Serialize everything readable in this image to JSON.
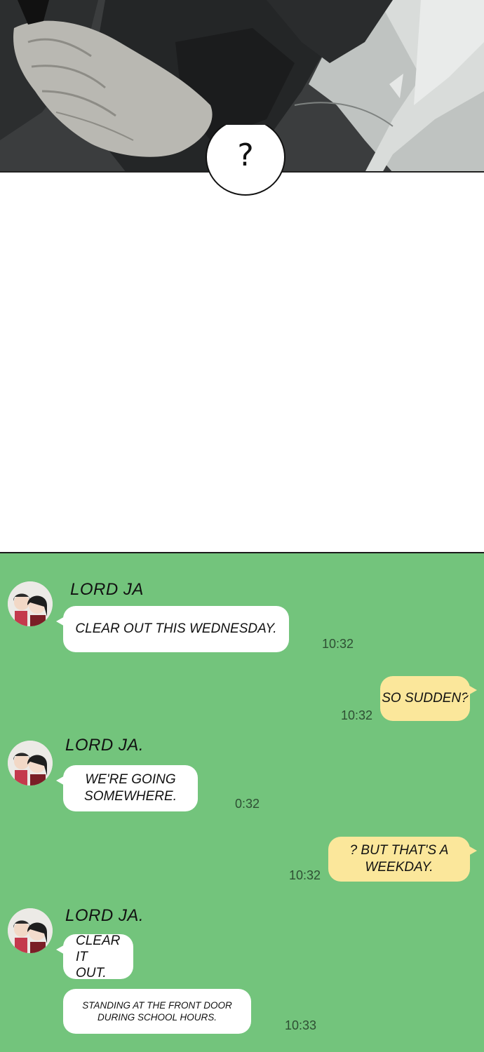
{
  "top_panel": {
    "speech_text": "?"
  },
  "chat": {
    "background_color": "#73c47c",
    "incoming_bubble_color": "#ffffff",
    "outgoing_bubble_color": "#fbe79b",
    "messages": [
      {
        "sender": "LORD JA",
        "text": "CLEAR OUT THIS WEDNESDAY.",
        "time": "10:32"
      },
      {
        "text": "SO SUDDEN?",
        "time": "10:32"
      },
      {
        "sender": "LORD JA.",
        "text": "WE'RE GOING SOMEWHERE.",
        "time": "0:32"
      },
      {
        "text": "? BUT THAT'S A WEEKDAY.",
        "time": "10:32"
      },
      {
        "sender": "LORD JA.",
        "text": "CLEAR IT OUT."
      },
      {
        "text": "STANDING AT THE FRONT DOOR DURING SCHOOL HOURS.",
        "time": "10:33"
      }
    ]
  }
}
